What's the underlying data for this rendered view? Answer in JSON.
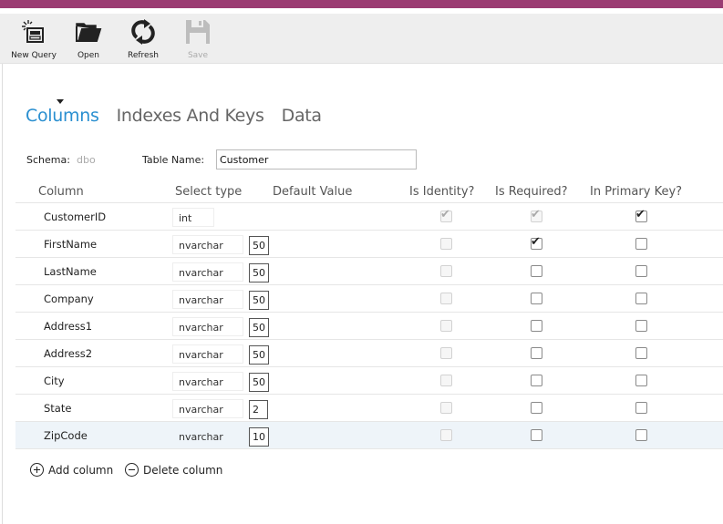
{
  "toolbar": {
    "new_query": "New Query",
    "open": "Open",
    "refresh": "Refresh",
    "save": "Save"
  },
  "tabs": [
    "Columns",
    "Indexes And Keys",
    "Data"
  ],
  "schema": {
    "label": "Schema:",
    "value": "dbo"
  },
  "table_name": {
    "label": "Table Name:",
    "value": "Customer"
  },
  "grid": {
    "headers": {
      "column": "Column",
      "type": "Select type",
      "default": "Default Value",
      "identity": "Is Identity?",
      "required": "Is Required?",
      "primary": "In Primary Key?"
    },
    "rows": [
      {
        "name": "CustomerID",
        "type": "int",
        "size": "",
        "identity": true,
        "required": true,
        "primary": true
      },
      {
        "name": "FirstName",
        "type": "nvarchar",
        "size": "50",
        "identity": false,
        "required": true,
        "primary": false
      },
      {
        "name": "LastName",
        "type": "nvarchar",
        "size": "50",
        "identity": false,
        "required": false,
        "primary": false
      },
      {
        "name": "Company",
        "type": "nvarchar",
        "size": "50",
        "identity": false,
        "required": false,
        "primary": false
      },
      {
        "name": "Address1",
        "type": "nvarchar",
        "size": "50",
        "identity": false,
        "required": false,
        "primary": false
      },
      {
        "name": "Address2",
        "type": "nvarchar",
        "size": "50",
        "identity": false,
        "required": false,
        "primary": false
      },
      {
        "name": "City",
        "type": "nvarchar",
        "size": "50",
        "identity": false,
        "required": false,
        "primary": false
      },
      {
        "name": "State",
        "type": "nvarchar",
        "size": "2",
        "identity": false,
        "required": false,
        "primary": false
      },
      {
        "name": "ZipCode",
        "type": "nvarchar",
        "size": "10",
        "identity": false,
        "required": false,
        "primary": false
      }
    ]
  },
  "actions": {
    "add": "Add column",
    "delete": "Delete column"
  },
  "colors": {
    "accent": "#2a8fd0",
    "title_bar": "#9b3b72",
    "toolbar_bg": "#eeeeee"
  }
}
